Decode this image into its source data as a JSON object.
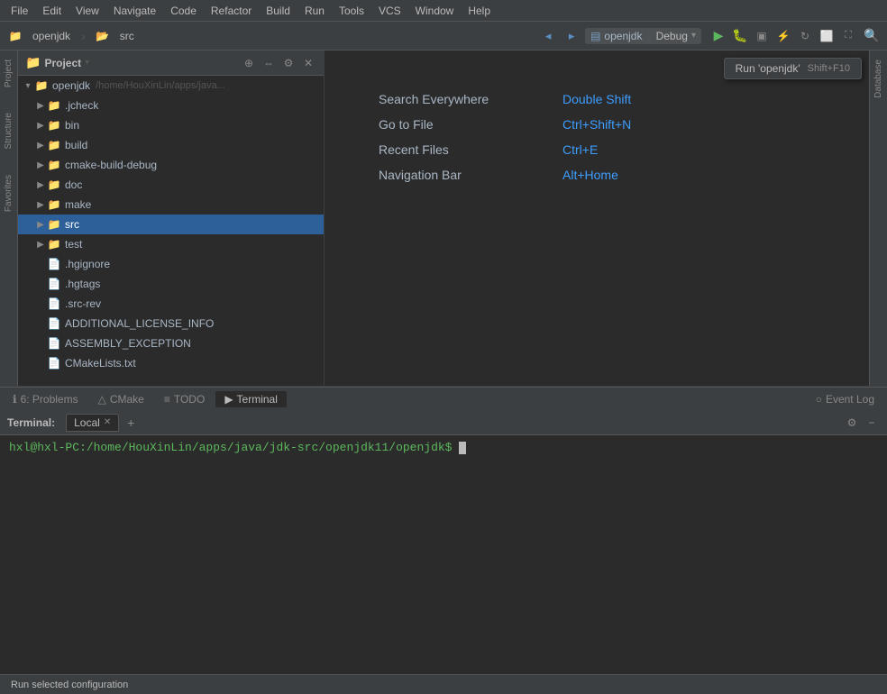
{
  "menubar": {
    "items": [
      "File",
      "Edit",
      "View",
      "Navigate",
      "Code",
      "Refactor",
      "Build",
      "Run",
      "Tools",
      "VCS",
      "Window",
      "Help"
    ]
  },
  "toolbar": {
    "project_name": "openjdk",
    "breadcrumb_sep": "›",
    "folder": "src",
    "run_config": "openjdk",
    "debug_config": "Debug",
    "run_tooltip": "Run 'openjdk'",
    "run_shortcut": "Shift+F10"
  },
  "project_panel": {
    "title": "Project",
    "root_name": "openjdk",
    "root_path": "/home/HouXinLin/apps/java...",
    "items": [
      {
        "name": ".jcheck",
        "type": "folder",
        "indent": 1,
        "expanded": false
      },
      {
        "name": "bin",
        "type": "folder",
        "indent": 1,
        "expanded": false
      },
      {
        "name": "build",
        "type": "folder",
        "indent": 1,
        "expanded": false
      },
      {
        "name": "cmake-build-debug",
        "type": "folder_yellow",
        "indent": 1,
        "expanded": false
      },
      {
        "name": "doc",
        "type": "folder",
        "indent": 1,
        "expanded": false
      },
      {
        "name": "make",
        "type": "folder",
        "indent": 1,
        "expanded": false
      },
      {
        "name": "src",
        "type": "folder",
        "indent": 1,
        "expanded": true,
        "selected": true
      },
      {
        "name": "test",
        "type": "folder",
        "indent": 1,
        "expanded": false
      },
      {
        "name": ".hgignore",
        "type": "file",
        "indent": 1
      },
      {
        "name": ".hgtags",
        "type": "file",
        "indent": 1
      },
      {
        "name": ".src-rev",
        "type": "file",
        "indent": 1
      },
      {
        "name": "ADDITIONAL_LICENSE_INFO",
        "type": "file",
        "indent": 1
      },
      {
        "name": "ASSEMBLY_EXCEPTION",
        "type": "file",
        "indent": 1
      },
      {
        "name": "CMakeLists.txt",
        "type": "file",
        "indent": 1
      }
    ]
  },
  "editor": {
    "quick_actions": [
      {
        "label": "Search Everywhere",
        "shortcut": "Double Shift"
      },
      {
        "label": "Go to File",
        "shortcut": "Ctrl+Shift+N"
      },
      {
        "label": "Recent Files",
        "shortcut": "Ctrl+E"
      },
      {
        "label": "Navigation Bar",
        "shortcut": "Alt+Home"
      }
    ]
  },
  "right_strip": {
    "label": "Database"
  },
  "terminal": {
    "title": "Terminal:",
    "tab_name": "Local",
    "prompt": "hxl@hxl-PC:/home/HouXinLin/apps/java/jdk-src/openjdk11/openjdk$"
  },
  "bottom_tools": {
    "items": [
      {
        "label": "6: Problems",
        "icon": "ℹ",
        "active": false
      },
      {
        "label": "CMake",
        "icon": "△",
        "active": false
      },
      {
        "label": "TODO",
        "icon": "≡",
        "active": false
      },
      {
        "label": "Terminal",
        "icon": "▶",
        "active": true
      }
    ],
    "event_log": "Event Log",
    "event_icon": "○"
  },
  "statusbar": {
    "message": "Run selected configuration"
  }
}
